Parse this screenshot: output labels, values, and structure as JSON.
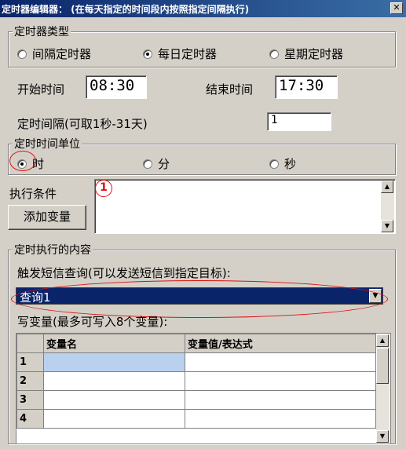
{
  "window": {
    "title": "定时器编辑器： (在每天指定的时间段内按照指定间隔执行)",
    "close": "✕"
  },
  "timer_type": {
    "legend": "定时器类型",
    "options": [
      {
        "label": "间隔定时器",
        "selected": false
      },
      {
        "label": "每日定时器",
        "selected": true
      },
      {
        "label": "星期定时器",
        "selected": false
      }
    ]
  },
  "schedule": {
    "start_label": "开始时间",
    "start_value": "08:30",
    "end_label": "结束时间",
    "end_value": "17:30",
    "interval_label": "定时间隔(可取1秒-31天)",
    "interval_value": "1"
  },
  "unit": {
    "legend": "定时时间单位",
    "options": [
      {
        "label": "时",
        "selected": true
      },
      {
        "label": "分",
        "selected": false
      },
      {
        "label": "秒",
        "selected": false
      }
    ]
  },
  "condition": {
    "label": "执行条件",
    "add_var_button": "添加变量",
    "marker": "1",
    "value": ""
  },
  "content": {
    "legend": "定时执行的内容",
    "trigger_label": "触发短信查询(可以发送短信到指定目标):",
    "trigger_selected": "查询1",
    "write_label": "写变量(最多可写入8个变量):",
    "table": {
      "headers": [
        "",
        "变量名",
        "变量值/表达式"
      ],
      "rows": [
        {
          "num": "1",
          "name": "",
          "value": ""
        },
        {
          "num": "2",
          "name": "",
          "value": ""
        },
        {
          "num": "3",
          "name": "",
          "value": ""
        },
        {
          "num": "4",
          "name": "",
          "value": ""
        }
      ]
    }
  },
  "colors": {
    "annotation": "#d11111",
    "selection": "#0a246a",
    "cell_selected": "#b9d1ee"
  }
}
